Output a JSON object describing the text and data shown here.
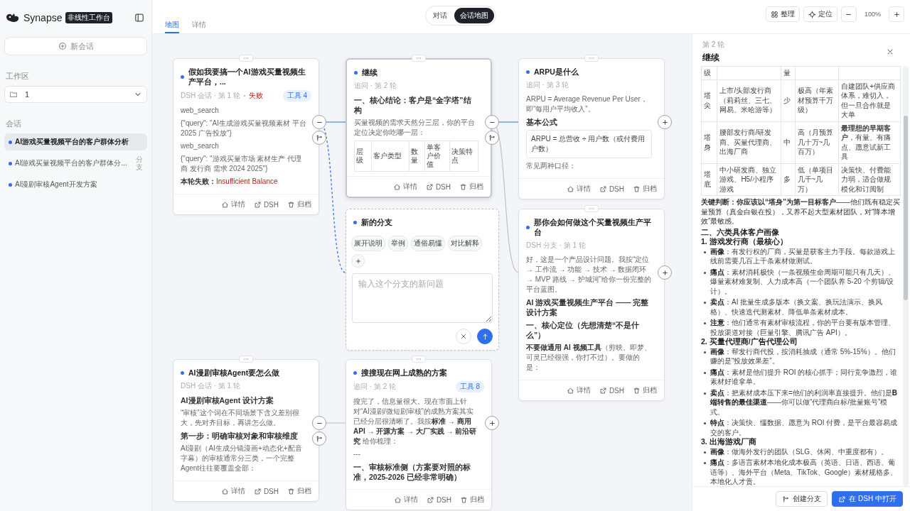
{
  "sidebar": {
    "brand": "Synapse",
    "badge": "非线性工作台",
    "new_button": "新会话",
    "workspace_label": "工作区",
    "workspace_value": "1",
    "sessions_label": "会话",
    "sessions": [
      {
        "title": "AI游戏买量视频平台的客户群体分析",
        "selected": true
      },
      {
        "title": "AI游戏买量视频平台的客户群体分...",
        "tag": "分支",
        "selected": false
      },
      {
        "title": "AI漫剧审核Agent开发方案",
        "selected": false
      }
    ]
  },
  "view_toggle": [
    {
      "label": "对话",
      "selected": false
    },
    {
      "label": "会话地图",
      "selected": true
    }
  ],
  "tabs": [
    {
      "label": "地图",
      "selected": true
    },
    {
      "label": "详情",
      "selected": false
    }
  ],
  "toolbar": {
    "arrange": "整理",
    "locate": "定位",
    "zoom": "100%"
  },
  "nodes": [
    {
      "kind": "turn",
      "title": "假如我要搞一个AI游戏买量视频生产平台，...",
      "meta": "DSH 会话 · 第 1 轮",
      "status": {
        "kind": "failed",
        "label": "失败"
      },
      "badge": "工具 4",
      "selected": false,
      "has_children": true,
      "blocks": [
        {
          "kind": "text",
          "text": "web_search"
        },
        {
          "kind": "text",
          "text": "{\"query\": \"AI生成游戏买量视频素材 平台 2025 广告投放\"}"
        },
        {
          "kind": "text",
          "text": "web_search"
        },
        {
          "kind": "text",
          "text": "{\"query\": \"游戏买量市场 素材生产 代理商 发行商 需求 2024 2025\"}"
        },
        {
          "kind": "error",
          "text": "**本轮失败：**Insufficient Balance"
        }
      ],
      "actions": [
        {
          "kind": "detail",
          "label": "详情"
        },
        {
          "kind": "open",
          "label": "DSH"
        },
        {
          "kind": "archive",
          "label": "归档"
        }
      ]
    },
    {
      "kind": "turn",
      "title": "继续",
      "meta": "追问 · 第 2 轮",
      "selected": true,
      "has_children": true,
      "blocks": [
        {
          "kind": "heading",
          "text": "一、核心结论：客户是“金字塔”结构"
        },
        {
          "kind": "text",
          "text": "买量视频的需求天然分三层，你的平台定位决定你吃哪一层："
        },
        {
          "kind": "table",
          "header": [
            "层级",
            "客户类型",
            "数量",
            "单客户价值",
            "决策特点"
          ]
        }
      ],
      "actions": [
        {
          "kind": "detail",
          "label": "详情"
        },
        {
          "kind": "open",
          "label": "DSH"
        },
        {
          "kind": "archive",
          "label": "归档"
        }
      ]
    },
    {
      "kind": "turn",
      "title": "ARPU是什么",
      "meta": "追问 · 第 3 轮",
      "selected": false,
      "has_children": false,
      "blocks": [
        {
          "kind": "text",
          "text": "ARPU = Average Revenue Per User，即“每用户平均收入”。"
        },
        {
          "kind": "heading",
          "text": "基本公式"
        },
        {
          "kind": "code",
          "text": "ARPU = 总营收 ÷ 用户数（或付费用户数）"
        },
        {
          "kind": "text",
          "text": "常见两种口径："
        }
      ],
      "actions": [
        {
          "kind": "detail",
          "label": "详情"
        },
        {
          "kind": "open",
          "label": "DSH"
        },
        {
          "kind": "archive",
          "label": "归档"
        }
      ]
    },
    {
      "kind": "draft",
      "title": "新的分支",
      "selected": false,
      "chips": [
        "展开说明",
        "举例",
        "通俗易懂",
        "对比解释"
      ],
      "placeholder": "输入这个分支的新问题"
    },
    {
      "kind": "turn",
      "title": "那你会如何做这个买量视频生产平台",
      "meta": "DSH 分支 · 第 1 轮",
      "selected": false,
      "has_children": false,
      "blocks": [
        {
          "kind": "text",
          "text": "好，这是一个产品设计问题。我按“定位 → 工作流 → 功能 → 技术 → 数据闭环 → MVP 路线 → 护城河”给你一份完整的平台蓝图。"
        },
        {
          "kind": "heading",
          "text": "AI 游戏买量视频生产平台 —— 完整设计方案"
        },
        {
          "kind": "heading",
          "text": "一、核心定位（先想清楚“不是什么”）"
        },
        {
          "kind": "text",
          "text": "**不要做通用 AI 视频工具**（剪映、即梦、可灵已经很强，你打不过）。要做的是："
        }
      ],
      "actions": [
        {
          "kind": "detail",
          "label": "详情"
        },
        {
          "kind": "open",
          "label": "DSH"
        },
        {
          "kind": "archive",
          "label": "归档"
        }
      ]
    },
    {
      "kind": "turn",
      "title": "AI漫剧审核Agent要怎么做",
      "meta": "DSH 会话 · 第 1 轮",
      "selected": false,
      "has_children": true,
      "blocks": [
        {
          "kind": "heading",
          "text": "AI漫剧审核Agent 设计方案"
        },
        {
          "kind": "text",
          "text": "“审核”这个词在不同场景下含义差别很大，先对齐目标，再讲怎么做。"
        },
        {
          "kind": "heading",
          "text": "第一步：明确审核对象和审核维度"
        },
        {
          "kind": "text",
          "text": "AI漫剧（AI生成分镜漫画+动态化+配音字幕）的审核通常分三类，一个完整Agent往往要覆盖全部："
        }
      ],
      "actions": [
        {
          "kind": "detail",
          "label": "详情"
        },
        {
          "kind": "open",
          "label": "DSH"
        },
        {
          "kind": "archive",
          "label": "归档"
        }
      ]
    },
    {
      "kind": "turn",
      "title": "搜搜现在网上成熟的方案",
      "meta": "追问 · 第 2 轮",
      "badge": "工具 8",
      "selected": false,
      "has_children": false,
      "blocks": [
        {
          "kind": "text",
          "text": "搜完了，信息量很大。现在市面上针对“AI漫剧/微短剧审核”的成熟方案其实已经分层很清晰了。我按**标准 → 商用API → 开源方案 → 大厂实践 → 前沿研究** 给你梳理："
        },
        {
          "kind": "text",
          "text": "---"
        },
        {
          "kind": "heading",
          "text": "一、审核标准侧（方案要对照的标准，2025-2026 已经非常明确）"
        }
      ],
      "actions": [
        {
          "kind": "detail",
          "label": "详情"
        },
        {
          "kind": "open",
          "label": "DSH"
        },
        {
          "kind": "archive",
          "label": "归档"
        }
      ]
    }
  ],
  "edges": [
    {
      "kind": "active"
    },
    {
      "kind": "draft"
    },
    {
      "kind": "active"
    },
    {
      "kind": "normal"
    },
    {
      "kind": "normal"
    }
  ],
  "detail": {
    "round": "第 2 轮",
    "title": "继续",
    "table": {
      "header": {
        "column_1": "级",
        "column_3": "量"
      },
      "rows": [
        [
          "塔尖",
          "上市/头部发行商（莉莉丝、三七、网易、米哈游等）",
          "少",
          "极高（年素材预算千万级）",
          "自建团队+供应商体系，难切入，但一旦合作就是大单"
        ],
        [
          "塔身",
          "腰部发行商/研发商、买量代理商、出海厂商",
          "中",
          "高（月预算几十万~几百万）",
          "**最理想的早期客户**，有量、有痛点、愿意试新工具"
        ],
        [
          "塔底",
          "中小研发商、独立游戏、H5/小程序游戏",
          "多",
          "低（单项目几千~几万）",
          "决策快、付费能力弱，适合做规模化和订阅制"
        ]
      ]
    },
    "blocks": [
      {
        "kind": "text",
        "text": "**关键判断：你应该以“塔身”为第一目标客户**——他们既有稳定买量预算（真金白银在投），又养不起大型素材团队，对“降本增效”最敏感。"
      },
      {
        "kind": "h2",
        "text": "二、六类具体客户画像"
      },
      {
        "kind": "h3",
        "text": "1. 游戏发行商（最核心）"
      },
      {
        "kind": "bullets",
        "items": [
          "**画像**：有发行权的厂商，买量是获客主力手段。每款游戏上线前需要几百上千条素材做测试。",
          "**痛点**：素材消耗极快（一条视频生命周期可能只有几天）、爆量素材难复制、人力成本高（一个团队养 5-20 个剪辑/设计）。",
          "**卖点**：AI 批量生成多版本（换文案、换玩法演示、换风格）、快速迭代测素材、降低单条素材成本。",
          "**注意**：他们通常有素材审核流程，你的平台要有版本管理、投放渠道对接（巨量引擎、腾讯广告 API）。"
        ]
      },
      {
        "kind": "h3",
        "text": "2. 买量代理商/广告代理公司"
      },
      {
        "kind": "bullets",
        "items": [
          "**画像**：帮发行商代投，按消耗抽成（通常 5%-15%）。他们赚的是“投放效果差”。",
          "**痛点**：素材是他们提升 ROI 的核心抓手；同行竞争激烈，谁素材好谁拿单。",
          "**卖点**：把素材成本压下来=他们的利润率直接提升。他们是**B端转售的最佳渠道**——你可以做“代理商白标/批量账号”模式。",
          "**特点**：决策快、懂数据、愿意为 ROI 付费，是平台最容易成交的客户。"
        ]
      },
      {
        "kind": "h3",
        "text": "3. 出海游戏厂商"
      },
      {
        "kind": "bullets",
        "items": [
          "**画像**：做海外发行的团队（SLG、休闲、中重度都有）。",
          "**痛点**：多语言素材本地化成本极高（英语、日语、西语、葡语等）、海外平台（Meta、TikTok、Google）素材规格多、本地化人才贵。"
        ]
      }
    ],
    "buttons": [
      {
        "kind": "branch",
        "label": "创建分支"
      },
      {
        "kind": "open",
        "label": "在 DSH 中打开"
      }
    ]
  }
}
